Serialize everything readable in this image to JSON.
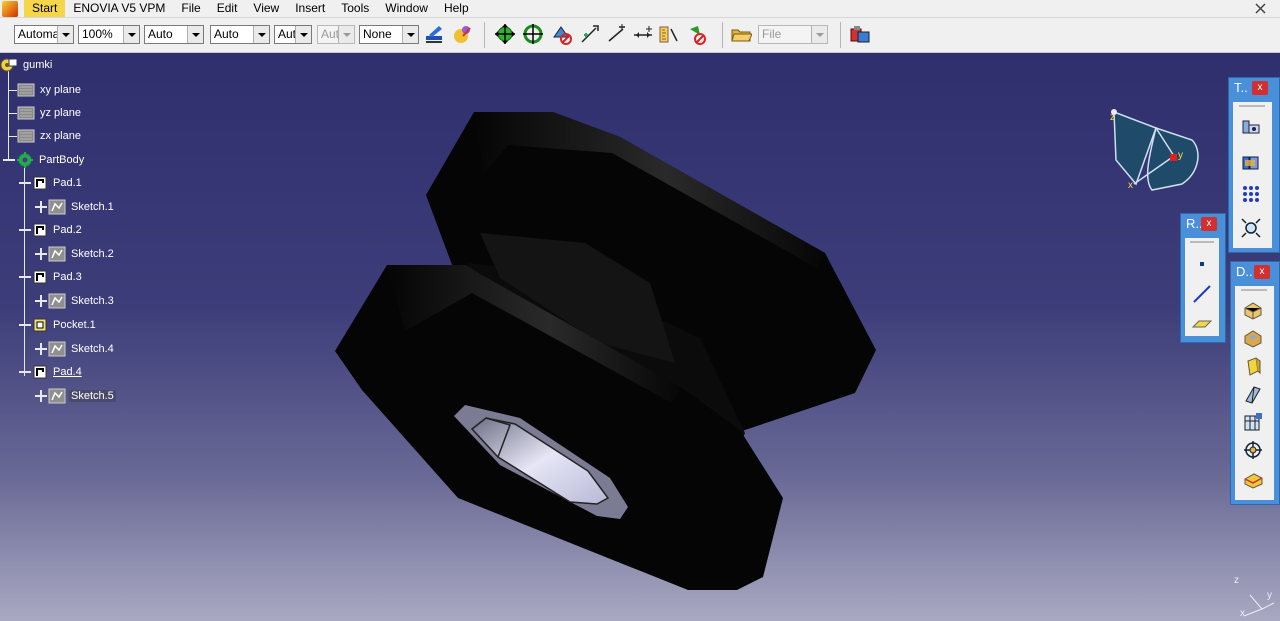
{
  "menu": {
    "items": [
      {
        "label": "Start"
      },
      {
        "label": "ENOVIA V5 VPM"
      },
      {
        "label": "File"
      },
      {
        "label": "Edit"
      },
      {
        "label": "View"
      },
      {
        "label": "Insert"
      },
      {
        "label": "Tools"
      },
      {
        "label": "Window"
      },
      {
        "label": "Help"
      }
    ]
  },
  "toolbar": {
    "combos": [
      "Automa",
      "100%",
      "Auto",
      "Auto",
      "Aut",
      "Aut",
      "None"
    ],
    "file_combo": "File",
    "icons": [
      "paint-brush-icon",
      "render-style-icon",
      "pan-icon",
      "rotate-icon",
      "swap-visible-icon",
      "zoom-in-icon",
      "snap-icon",
      "dimension-icon",
      "measure-icon",
      "hide-show-icon",
      "open-folder-icon",
      "catalog-icon"
    ]
  },
  "tree": {
    "root": "gumki",
    "planes": [
      "xy plane",
      "yz plane",
      "zx plane"
    ],
    "body": "PartBody",
    "features": [
      {
        "label": "Pad.1",
        "sketch": "Sketch.1"
      },
      {
        "label": "Pad.2",
        "sketch": "Sketch.2"
      },
      {
        "label": "Pad.3",
        "sketch": "Sketch.3"
      },
      {
        "label": "Pocket.1",
        "sketch": "Sketch.4"
      },
      {
        "label": "Pad.4",
        "sketch": "Sketch.5"
      }
    ]
  },
  "panels": {
    "t_title": "T..",
    "r_title": "R..",
    "d_title": "D..",
    "close": "x"
  },
  "compass": {
    "x_label": "x",
    "y_label": "y",
    "z_label": "z"
  },
  "axis": {
    "x_label": "x",
    "y_label": "y",
    "z_label": "z"
  },
  "colors": {
    "viewport_top": "#2f2f6e",
    "viewport_bottom": "#a9a9c2",
    "accent": "#4a90d9",
    "highlight": "#f5d54a"
  }
}
